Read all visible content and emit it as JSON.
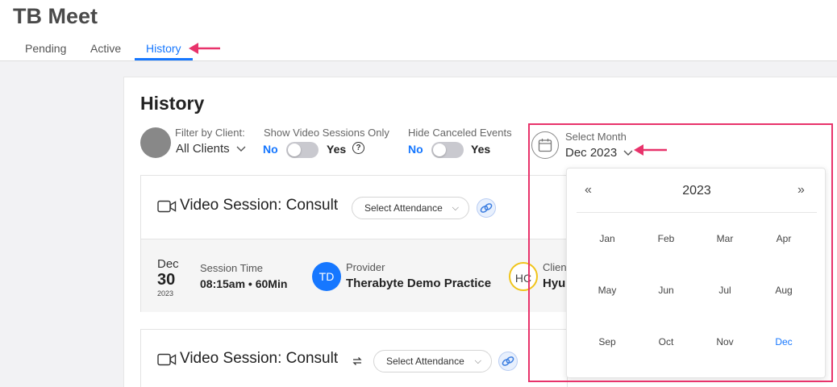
{
  "app": {
    "title": "TB Meet"
  },
  "tabs": [
    {
      "label": "Pending"
    },
    {
      "label": "Active"
    },
    {
      "label": "History"
    }
  ],
  "page": {
    "title": "History"
  },
  "filters": {
    "client": {
      "label": "Filter by Client:",
      "value": "All Clients"
    },
    "video_only": {
      "label": "Show Video Sessions Only",
      "off": "No",
      "on": "Yes",
      "help": "?"
    },
    "hide_canceled": {
      "label": "Hide Canceled Events",
      "off": "No",
      "on": "Yes"
    },
    "month": {
      "label": "Select Month",
      "value": "Dec 2023"
    }
  },
  "sessions": [
    {
      "title": "Video Session: Consult",
      "attendance": "Select Attendance",
      "date": {
        "month": "Dec",
        "day": "30",
        "year": "2023"
      },
      "time": {
        "label": "Session Time",
        "value": "08:15am • 60Min"
      },
      "provider": {
        "label": "Provider",
        "name": "Therabyte Demo Practice",
        "initials": "TD"
      },
      "client": {
        "label": "Clien",
        "name": "Hyun",
        "initials": "HC"
      }
    },
    {
      "title": "Video Session: Consult",
      "attendance": "Select Attendance"
    }
  ],
  "month_picker": {
    "year": "2023",
    "prev": "«",
    "next": "»",
    "months": [
      "Jan",
      "Feb",
      "Mar",
      "Apr",
      "May",
      "Jun",
      "Jul",
      "Aug",
      "Sep",
      "Oct",
      "Nov",
      "Dec"
    ],
    "selected": "Dec"
  },
  "colors": {
    "accent": "#1677ff",
    "annotation": "#e8336b"
  }
}
